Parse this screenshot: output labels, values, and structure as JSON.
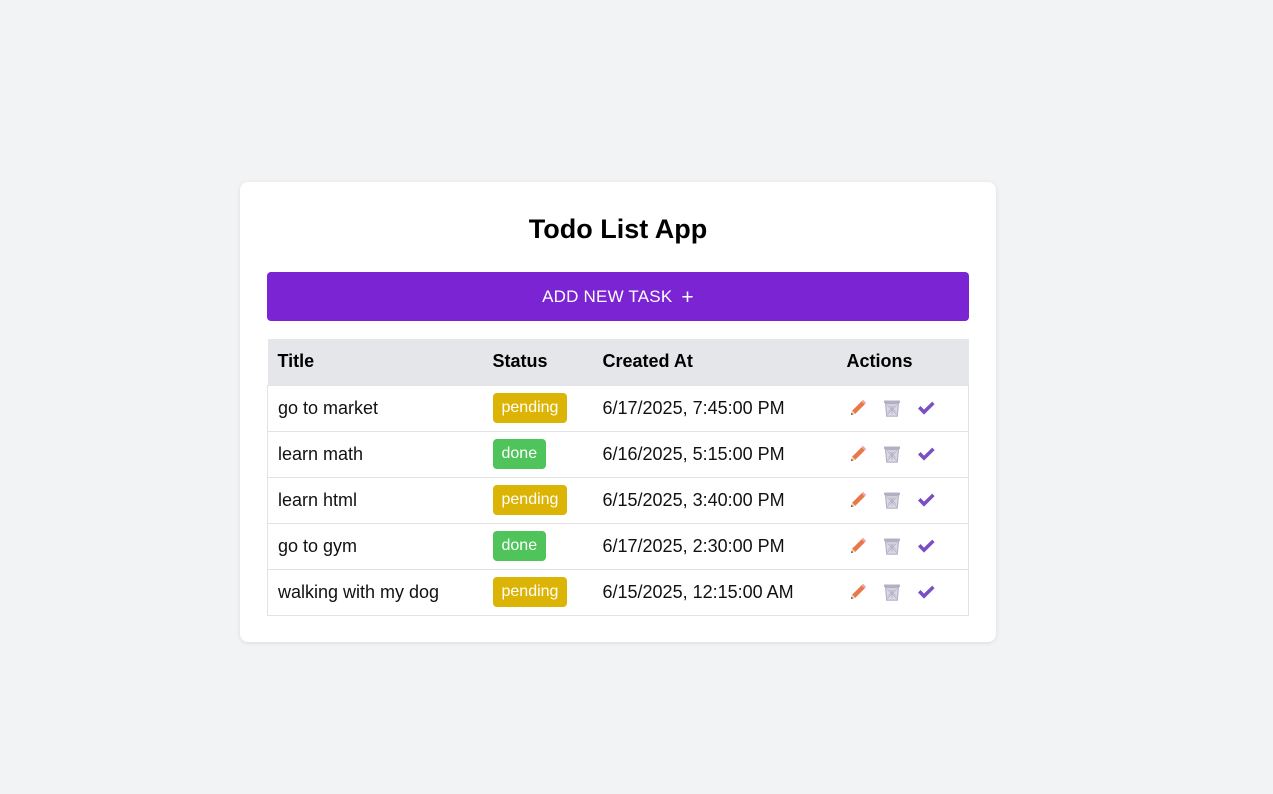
{
  "app": {
    "title": "Todo List App",
    "add_button_label": "ADD NEW TASK",
    "add_button_icon": "+"
  },
  "table": {
    "headers": {
      "title": "Title",
      "status": "Status",
      "created_at": "Created At",
      "actions": "Actions"
    },
    "rows": [
      {
        "title": "go to market",
        "status": "pending",
        "created_at": "6/17/2025, 7:45:00 PM"
      },
      {
        "title": "learn math",
        "status": "done",
        "created_at": "6/16/2025, 5:15:00 PM"
      },
      {
        "title": "learn html",
        "status": "pending",
        "created_at": "6/15/2025, 3:40:00 PM"
      },
      {
        "title": "go to gym",
        "status": "done",
        "created_at": "6/17/2025, 2:30:00 PM"
      },
      {
        "title": "walking with my dog",
        "status": "pending",
        "created_at": "6/15/2025, 12:15:00 AM"
      }
    ],
    "row_actions": [
      "pencil-icon",
      "trash-icon",
      "check-icon"
    ]
  },
  "colors": {
    "page_background": "#f2f3f5",
    "accent": "#7b24d3",
    "pending": "#dcb406",
    "done": "#4fc45a",
    "header_background": "#e5e6e9",
    "edit_icon": "#e8774a",
    "delete_icon": "#b4b0c4",
    "complete_icon": "#7a4ec4"
  }
}
